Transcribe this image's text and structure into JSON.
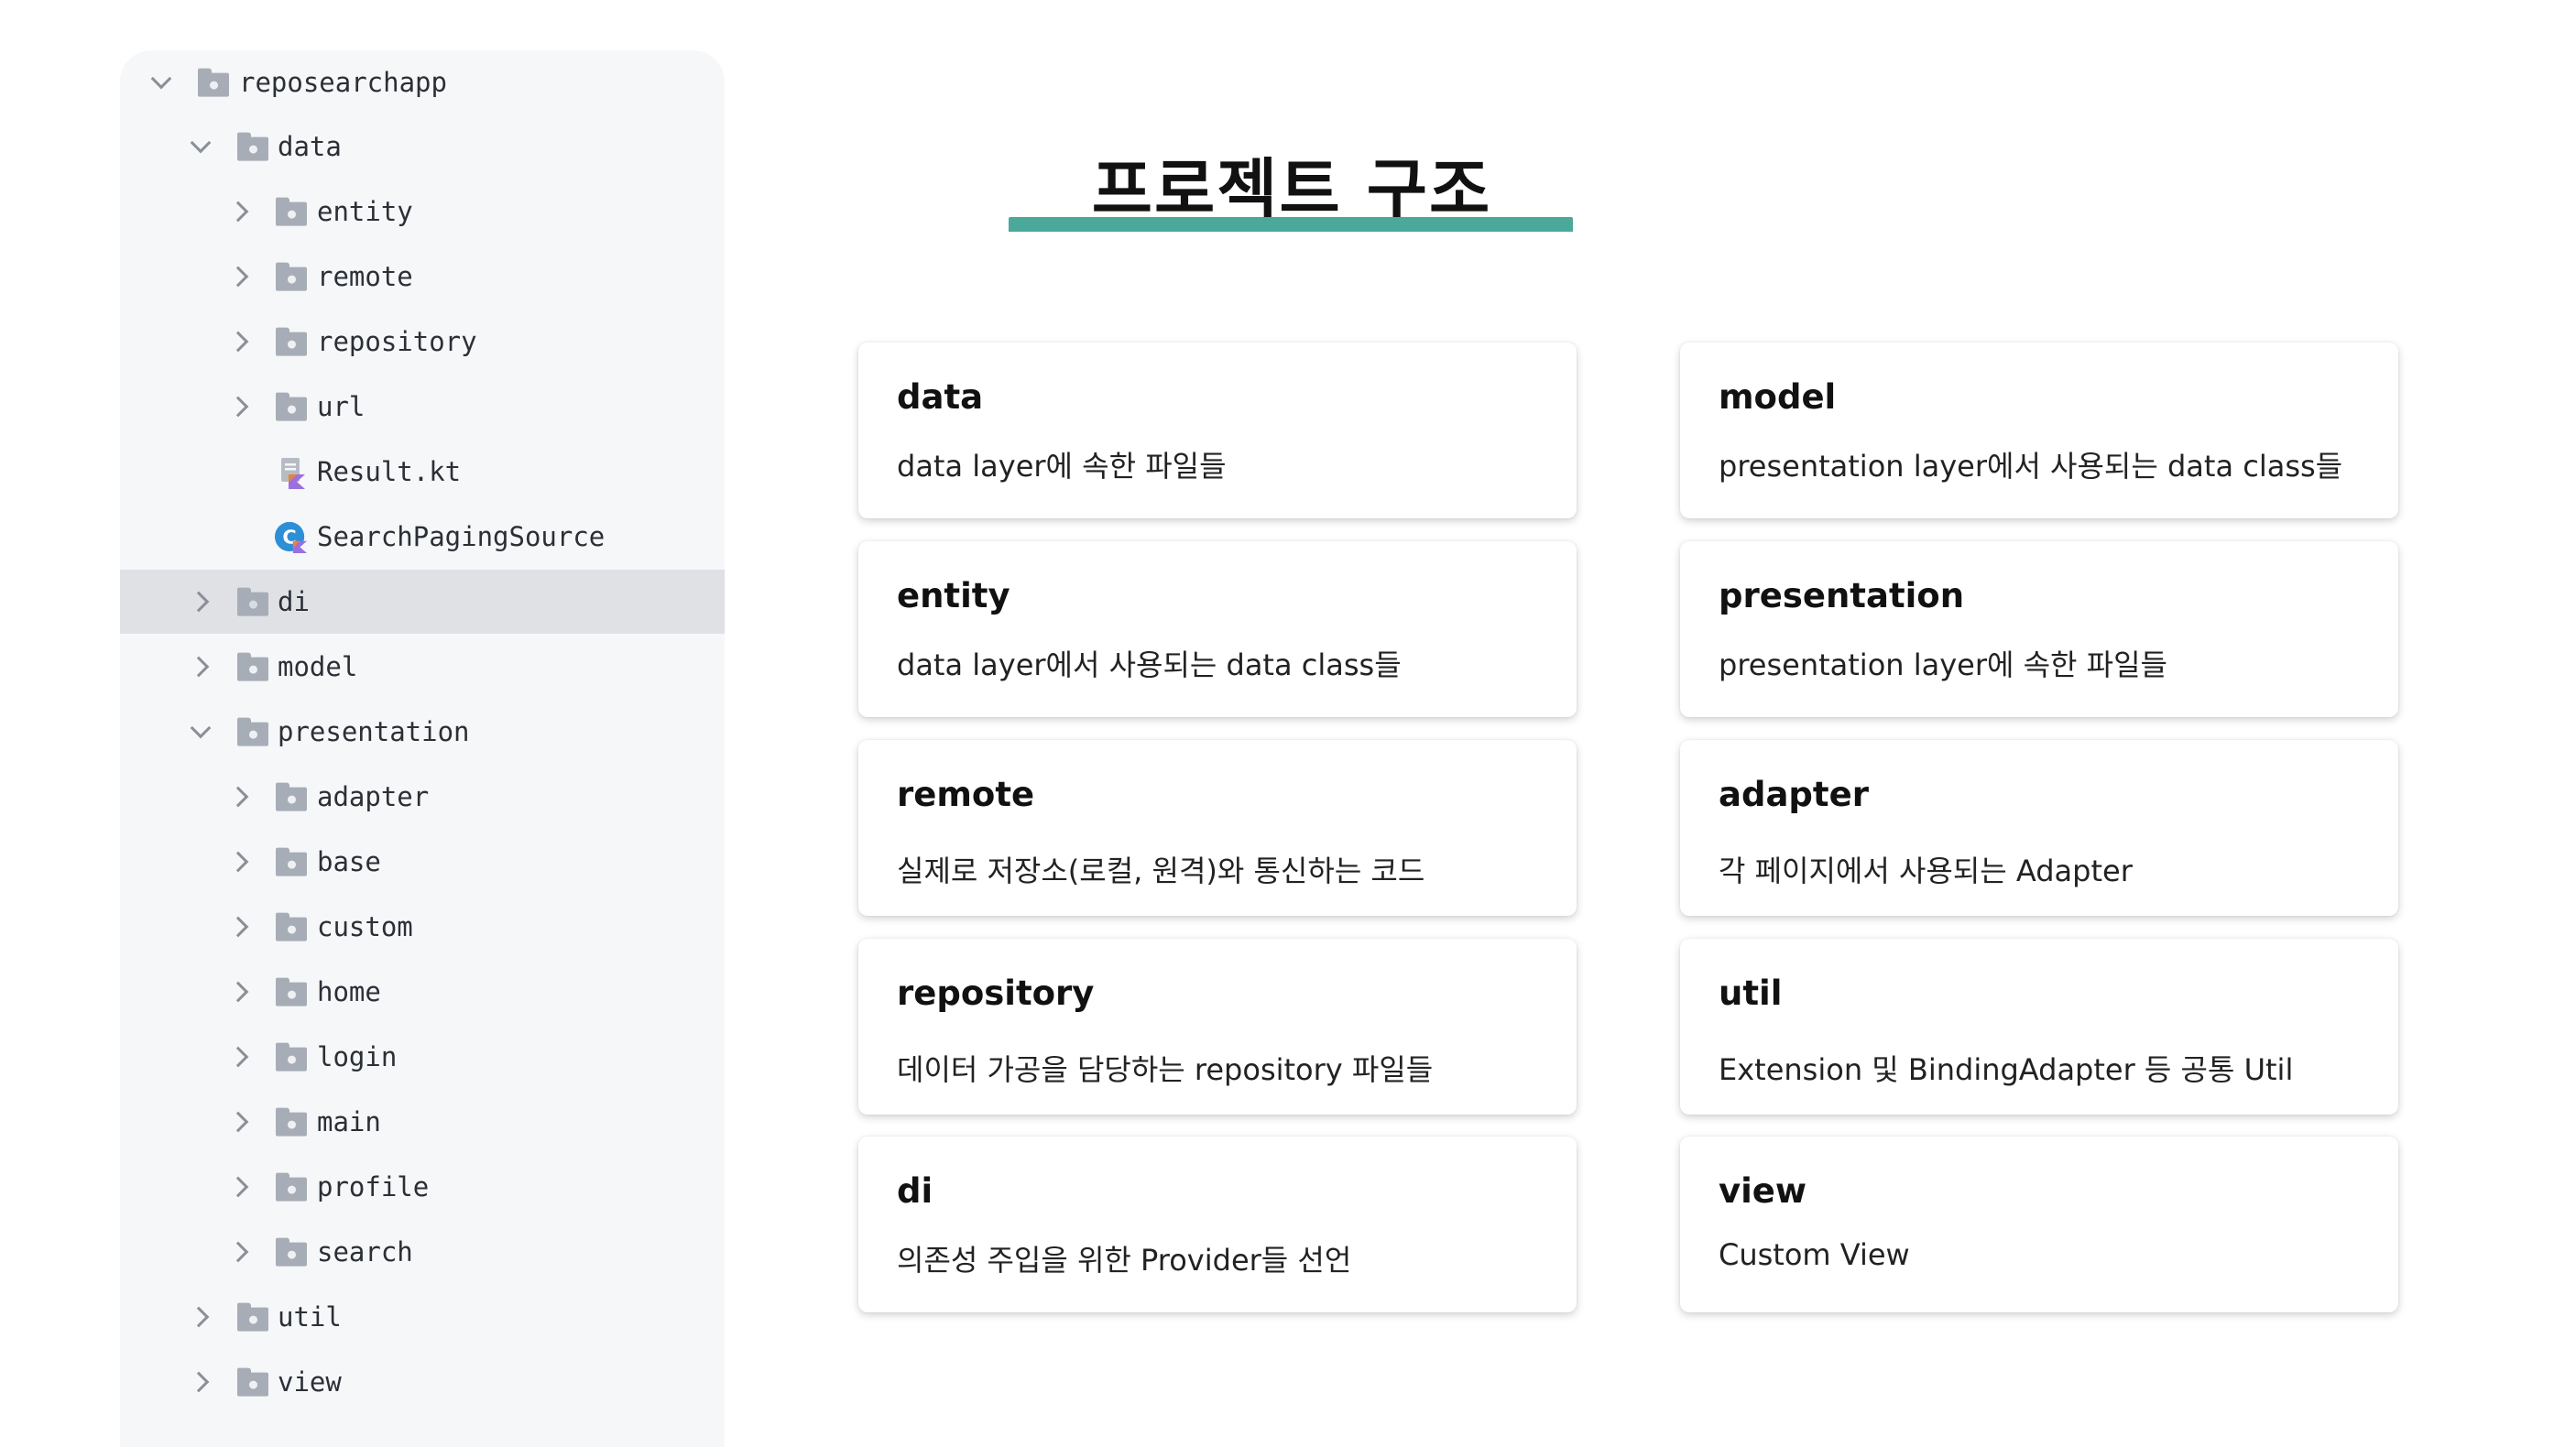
{
  "tree": {
    "items": [
      {
        "label": "reposearchapp",
        "icon": "folder-icon",
        "expanded": true
      },
      {
        "label": "data",
        "icon": "folder-icon",
        "expanded": true
      },
      {
        "label": "entity",
        "icon": "folder-icon",
        "expanded": false
      },
      {
        "label": "remote",
        "icon": "folder-icon",
        "expanded": false
      },
      {
        "label": "repository",
        "icon": "folder-icon",
        "expanded": false
      },
      {
        "label": "url",
        "icon": "folder-icon",
        "expanded": false
      },
      {
        "label": "Result.kt",
        "icon": "kotlin-file-icon"
      },
      {
        "label": "SearchPagingSource",
        "icon": "kotlin-class-icon"
      },
      {
        "label": "di",
        "icon": "folder-icon",
        "expanded": false,
        "selected": true
      },
      {
        "label": "model",
        "icon": "folder-icon",
        "expanded": false
      },
      {
        "label": "presentation",
        "icon": "folder-icon",
        "expanded": true
      },
      {
        "label": "adapter",
        "icon": "folder-icon",
        "expanded": false
      },
      {
        "label": "base",
        "icon": "folder-icon",
        "expanded": false
      },
      {
        "label": "custom",
        "icon": "folder-icon",
        "expanded": false
      },
      {
        "label": "home",
        "icon": "folder-icon",
        "expanded": false
      },
      {
        "label": "login",
        "icon": "folder-icon",
        "expanded": false
      },
      {
        "label": "main",
        "icon": "folder-icon",
        "expanded": false
      },
      {
        "label": "profile",
        "icon": "folder-icon",
        "expanded": false
      },
      {
        "label": "search",
        "icon": "folder-icon",
        "expanded": false
      },
      {
        "label": "util",
        "icon": "folder-icon",
        "expanded": false
      },
      {
        "label": "view",
        "icon": "folder-icon",
        "expanded": false
      }
    ]
  },
  "header": {
    "title": "프로젝트 구조",
    "accent_color": "#4aa99a"
  },
  "cards": [
    {
      "title": "data",
      "desc": "data layer에 속한 파일들"
    },
    {
      "title": "entity",
      "desc": "data layer에서 사용되는 data class들"
    },
    {
      "title": "remote",
      "desc": "실제로 저장소(로컬, 원격)와 통신하는 코드"
    },
    {
      "title": "repository",
      "desc": "데이터 가공을 담당하는 repository 파일들"
    },
    {
      "title": "di",
      "desc": "의존성 주입을 위한 Provider들 선언"
    },
    {
      "title": "model",
      "desc": "presentation layer에서 사용되는 data class들"
    },
    {
      "title": "presentation",
      "desc": "presentation layer에 속한 파일들"
    },
    {
      "title": "adapter",
      "desc": "각 페이지에서 사용되는 Adapter"
    },
    {
      "title": "util",
      "desc": "Extension 및 BindingAdapter 등 공통 Util"
    },
    {
      "title": "view",
      "desc": "Custom View"
    }
  ]
}
